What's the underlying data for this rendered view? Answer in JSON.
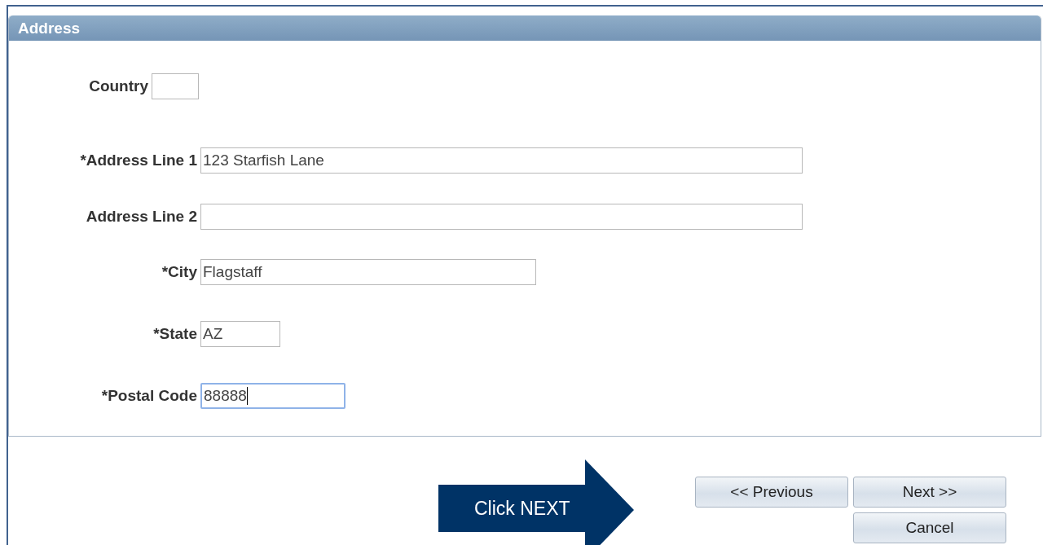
{
  "section": {
    "title": "Address"
  },
  "fields": [
    {
      "label": "Country",
      "focused": false
    },
    {
      "label": "*Address Line 1",
      "value": "123 Starfish Lane",
      "focused": false
    },
    {
      "label": "Address Line 2",
      "focused": false
    },
    {
      "label": "*City",
      "value": "Flagstaff",
      "focused": false
    },
    {
      "label": "*State",
      "value": "AZ",
      "focused": false
    },
    {
      "label": "*Postal Code",
      "value": "88888",
      "focused": true
    }
  ],
  "callout": {
    "text": "Click NEXT"
  },
  "buttons": [
    {
      "label": "<< Previous"
    },
    {
      "label": "Next >>"
    },
    {
      "label": "Cancel"
    }
  ]
}
